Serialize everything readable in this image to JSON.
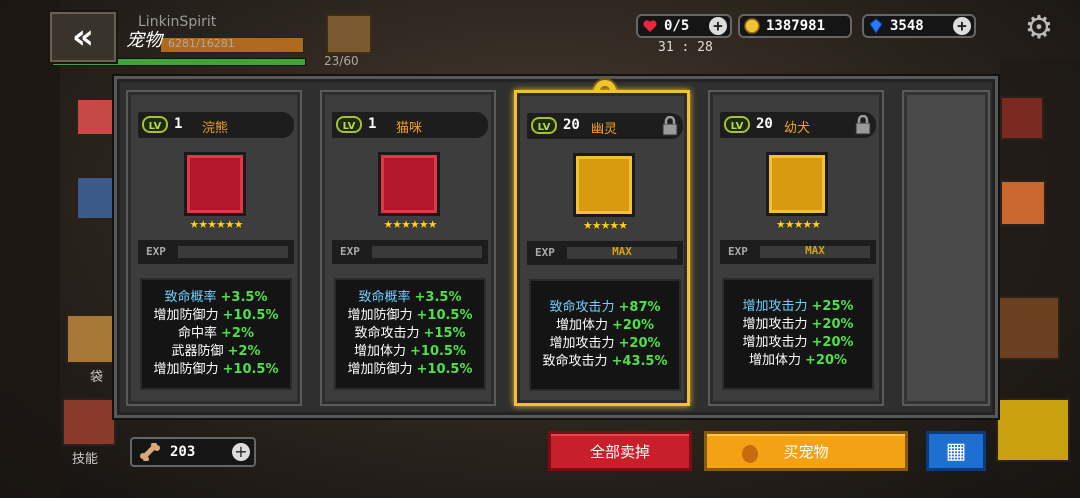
{
  "header": {
    "page_title": "宠物",
    "player_name": "LinkinSpirit",
    "hp_text": "6281/16281",
    "inventory_count": "23/60",
    "hearts": "0/5",
    "gold": "1387981",
    "gems": "3548",
    "timer": "31 : 28"
  },
  "pets": [
    {
      "level": "1",
      "name": "浣熊",
      "locked": false,
      "selected": false,
      "exp_max": false,
      "exp_max_label": "",
      "portrait": "red",
      "stars": "★★★★★★",
      "stats": [
        {
          "label": "致命概率",
          "value": "+3.5%",
          "hi": true
        },
        {
          "label": "增加防御力",
          "value": "+10.5%",
          "hi": false
        },
        {
          "label": "命中率",
          "value": "+2%",
          "hi": false
        },
        {
          "label": "武器防御",
          "value": "+2%",
          "hi": false
        },
        {
          "label": "增加防御力",
          "value": "+10.5%",
          "hi": false
        }
      ]
    },
    {
      "level": "1",
      "name": "猫咪",
      "locked": false,
      "selected": false,
      "exp_max": false,
      "exp_max_label": "",
      "portrait": "red",
      "stars": "★★★★★★",
      "stats": [
        {
          "label": "致命概率",
          "value": "+3.5%",
          "hi": true
        },
        {
          "label": "增加防御力",
          "value": "+10.5%",
          "hi": false
        },
        {
          "label": "致命攻击力",
          "value": "+15%",
          "hi": false
        },
        {
          "label": "增加体力",
          "value": "+10.5%",
          "hi": false
        },
        {
          "label": "增加防御力",
          "value": "+10.5%",
          "hi": false
        }
      ]
    },
    {
      "level": "20",
      "name": "幽灵",
      "locked": true,
      "selected": true,
      "exp_max": true,
      "exp_max_label": "MAX",
      "portrait": "gold",
      "stars": "★★★★★",
      "stats": [
        {
          "label": "致命攻击力",
          "value": "+87%",
          "hi": true
        },
        {
          "label": "增加体力",
          "value": "+20%",
          "hi": false
        },
        {
          "label": "增加攻击力",
          "value": "+20%",
          "hi": false
        },
        {
          "label": "致命攻击力",
          "value": "+43.5%",
          "hi": false
        }
      ]
    },
    {
      "level": "20",
      "name": "幼犬",
      "locked": true,
      "selected": false,
      "exp_max": true,
      "exp_max_label": "MAX",
      "portrait": "gold",
      "stars": "★★★★★",
      "stats": [
        {
          "label": "增加攻击力",
          "value": "+25%",
          "hi": true
        },
        {
          "label": "增加攻击力",
          "value": "+20%",
          "hi": false
        },
        {
          "label": "增加攻击力",
          "value": "+20%",
          "hi": false
        },
        {
          "label": "增加体力",
          "value": "+20%",
          "hi": false
        }
      ]
    }
  ],
  "exp_label": "EXP",
  "lv_label": "LV",
  "bottom": {
    "bone_count": "203",
    "sell_all_label": "全部卖掉",
    "buy_pet_label": "买宠物"
  },
  "side": {
    "bag_label": "袋",
    "skill_label": "技能"
  },
  "colors": {
    "stat_value": "#4fe04a",
    "stat_highlight": "#6fd0ff",
    "pet_name": "#f3a020",
    "selected_border": "#f1c232",
    "sell_button": "#c8202a",
    "buy_button": "#f3a214",
    "grid_button": "#1e6fd0"
  },
  "icons": [
    "back-chevron-icon",
    "heart-icon",
    "coin-icon",
    "gem-icon",
    "plus-icon",
    "gear-icon",
    "lock-icon",
    "paw-icon",
    "bone-icon",
    "egg-icon",
    "grid-icon"
  ]
}
